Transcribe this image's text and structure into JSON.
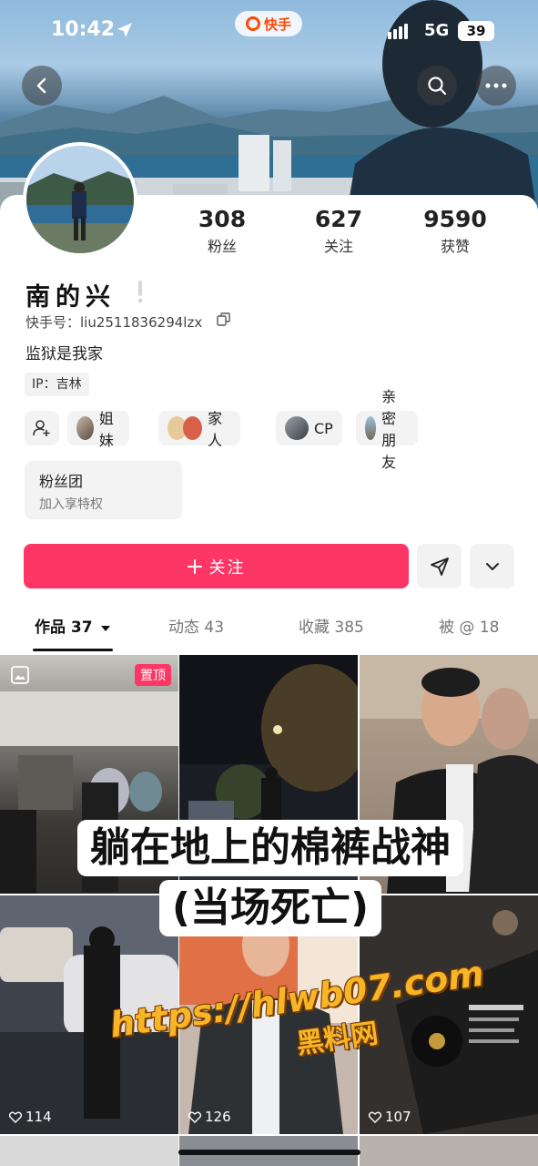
{
  "status": {
    "time": "10:42",
    "app_name": "快手",
    "network": "5G",
    "battery": "39"
  },
  "profile": {
    "followers": "308",
    "followers_label": "粉丝",
    "following": "627",
    "following_label": "关注",
    "likes": "9590",
    "likes_label": "获赞",
    "name": "南的兴",
    "kuaishou_id": "快手号：liu2511836294lzx",
    "bio": "监狱是我家",
    "ip": "IP：吉林"
  },
  "relations": [
    {
      "label": "姐妹"
    },
    {
      "label": "家人"
    },
    {
      "label": "CP"
    },
    {
      "label": "亲密朋友"
    }
  ],
  "fan_club": {
    "title": "粉丝团",
    "subtitle": "加入享特权"
  },
  "actions": {
    "follow_label": "关注"
  },
  "tabs": [
    {
      "label": "作品 37",
      "active": true
    },
    {
      "label": "动态 43",
      "active": false
    },
    {
      "label": "收藏 385",
      "active": false
    },
    {
      "label": "被 @ 18",
      "active": false
    }
  ],
  "grid": {
    "pinned_label": "置顶",
    "likes": [
      "114",
      "126",
      "107"
    ]
  },
  "overlay": {
    "caption_line1": "躺在地上的棉裤战神",
    "caption_line2": "(当场死亡)",
    "watermark_url": "https://hlwb07.com",
    "watermark_name": "黑料网"
  },
  "colors": {
    "accent": "#fe3666",
    "brand": "#ff4906"
  }
}
